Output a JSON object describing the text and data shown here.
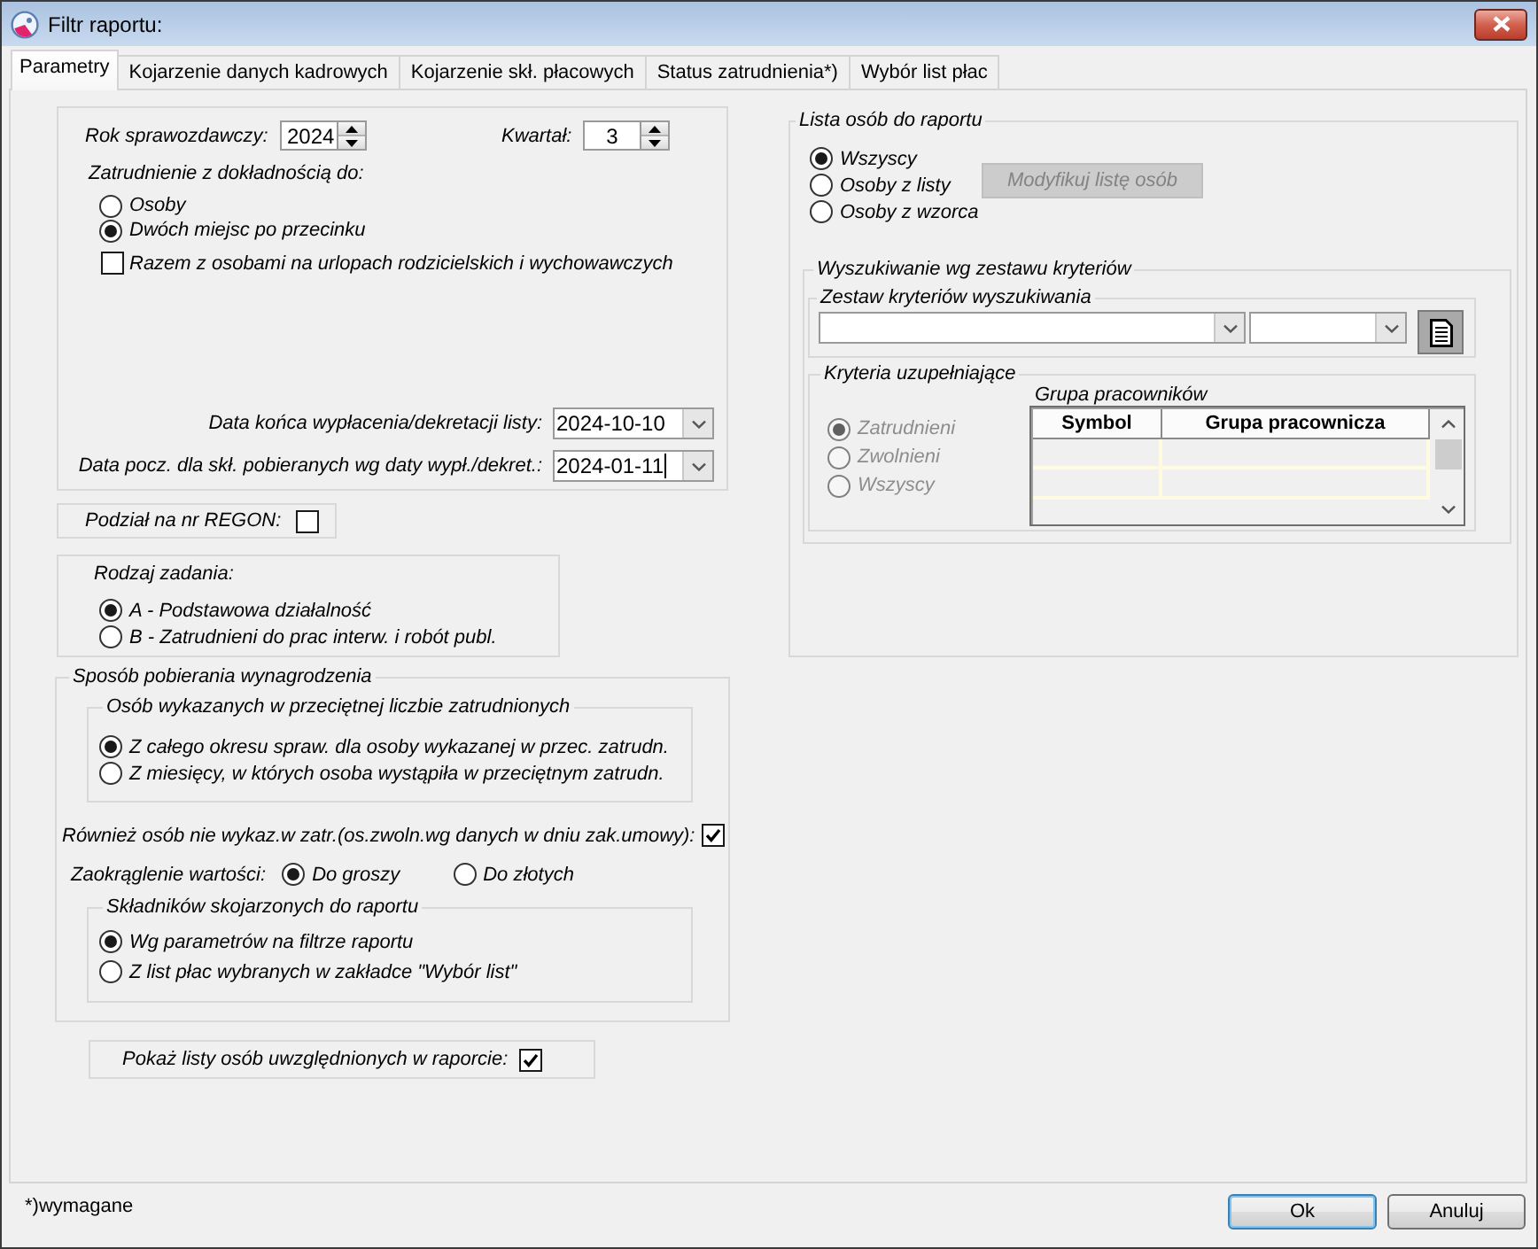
{
  "window": {
    "title": "Filtr raportu:"
  },
  "tabs": [
    {
      "label": "Parametry",
      "selected": true
    },
    {
      "label": "Kojarzenie danych kadrowych",
      "selected": false
    },
    {
      "label": "Kojarzenie skł. płacowych",
      "selected": false
    },
    {
      "label": "Status zatrudnienia*)",
      "selected": false
    },
    {
      "label": "Wybór list płac",
      "selected": false
    }
  ],
  "parameters": {
    "year": {
      "label": "Rok sprawozdawczy:",
      "value": "2024"
    },
    "quarter": {
      "label": "Kwartał:",
      "value": "3"
    },
    "employment_precision": {
      "label": "Zatrudnienie z dokładnością do:",
      "options": [
        {
          "label": "Osoby",
          "selected": false
        },
        {
          "label": "Dwóch miejsc po przecinku",
          "selected": true
        }
      ]
    },
    "include_parental_leave": {
      "label": "Razem z osobami na urlopach rodzicielskich i wychowawczych",
      "checked": false
    },
    "payout_end_date": {
      "label": "Data końca wypłacenia/dekretacji listy:",
      "value": "2024-10-10",
      "focused": false
    },
    "start_date": {
      "label": "Data pocz. dla skł. pobieranych wg daty wypł./dekret.:",
      "value": "2024-01-11",
      "focused": true
    },
    "regon_split": {
      "label": "Podział na nr REGON:",
      "checked": false
    },
    "task_type": {
      "label": "Rodzaj zadania:",
      "options": [
        {
          "label": "A - Podstawowa działalność",
          "selected": true
        },
        {
          "label": "B - Zatrudnieni do prac interw. i robót publ.",
          "selected": false
        }
      ]
    },
    "salary_method": {
      "title": "Sposób pobierania wynagrodzenia",
      "average_employment": {
        "title": "Osób wykazanych w przeciętnej liczbie zatrudnionych",
        "options": [
          {
            "label": "Z całego okresu spraw. dla osoby wykazanej w przec. zatrudn.",
            "selected": true
          },
          {
            "label": "Z miesięcy, w których osoba wystąpiła w przeciętnym zatrudn.",
            "selected": false
          }
        ]
      },
      "include_not_listed": {
        "label": "Również osób nie wykaz.w zatr.(os.zwoln.wg danych w dniu zak.umowy):",
        "checked": true
      },
      "rounding": {
        "label": "Zaokrąglenie wartości:",
        "options": [
          {
            "label": "Do groszy",
            "selected": true
          },
          {
            "label": "Do złotych",
            "selected": false
          }
        ]
      },
      "components": {
        "title": "Składników skojarzonych do raportu",
        "options": [
          {
            "label": "Wg parametrów na filtrze raportu",
            "selected": true
          },
          {
            "label": "Z list płac wybranych w zakładce \"Wybór list\"",
            "selected": false
          }
        ]
      }
    },
    "show_lists": {
      "label": "Pokaż listy osób uwzględnionych w raporcie:",
      "checked": true
    }
  },
  "people_list": {
    "title": "Lista osób do raportu",
    "options": [
      {
        "label": "Wszyscy",
        "selected": true
      },
      {
        "label": "Osoby z listy",
        "selected": false
      },
      {
        "label": "Osoby z wzorca",
        "selected": false
      }
    ],
    "modify_button": {
      "label": "Modyfikuj listę osób",
      "disabled": true
    },
    "criteria_search": {
      "title": "Wyszukiwanie wg zestawu kryteriów",
      "criteria_set": {
        "title": "Zestaw kryteriów wyszukiwania"
      },
      "supplementary": {
        "title": "Kryteria uzupełniające",
        "options": [
          {
            "label": "Zatrudnieni",
            "selected": true,
            "disabled": true
          },
          {
            "label": "Zwolnieni",
            "selected": false,
            "disabled": true
          },
          {
            "label": "Wszyscy",
            "selected": false,
            "disabled": true
          }
        ],
        "employee_group": {
          "title": "Grupa pracowników",
          "columns": [
            "Symbol",
            "Grupa pracownicza"
          ]
        }
      }
    }
  },
  "footer": {
    "note": "*)wymagane",
    "buttons": [
      {
        "label": "Ok",
        "default": true
      },
      {
        "label": "Anuluj",
        "default": false
      }
    ]
  }
}
